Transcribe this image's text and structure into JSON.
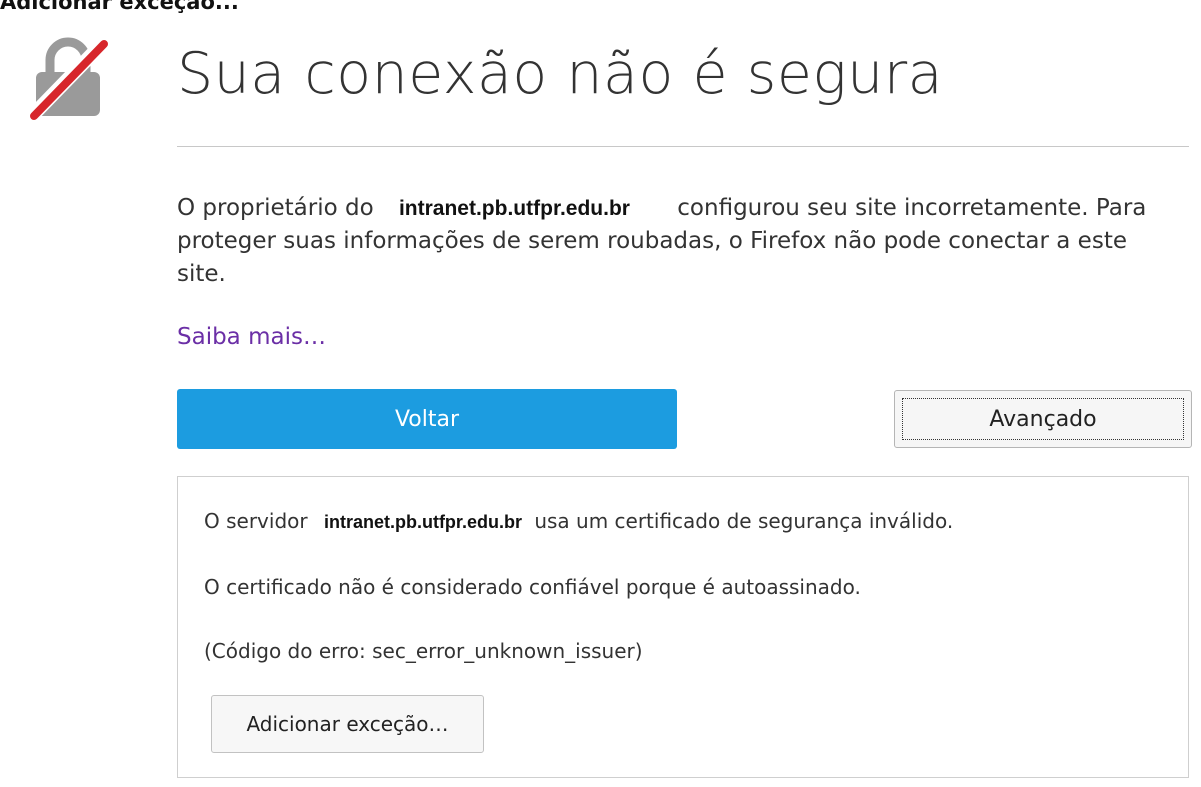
{
  "caption": "Adicionar exceção...",
  "header": {
    "title": "Sua conexão não é segura"
  },
  "intro": {
    "prefix": "O proprietário do",
    "host": "intranet.pb.utfpr.edu.br",
    "suffix": "configurou seu site incorretamente. Para proteger suas informações de serem roubadas, o Firefox não pode conectar a este site."
  },
  "learn_more": "Saiba mais…",
  "buttons": {
    "back": "Voltar",
    "advanced": "Avançado"
  },
  "advanced_panel": {
    "line1_prefix": "O servidor",
    "line1_host": "intranet.pb.utfpr.edu.br",
    "line1_suffix": "usa um certificado de segurança inválido.",
    "line2": "O certificado não é considerado confiável porque é autoassinado.",
    "line3": "(Código do erro: sec_error_unknown_issuer)",
    "add_exception": "Adicionar exceção…"
  },
  "colors": {
    "primary_button": "#1c9ce0",
    "link": "#6b2fa6",
    "strike": "#d7262b",
    "lock": "#9a9a9a"
  },
  "icons": {
    "lock": "broken-lock-icon"
  }
}
